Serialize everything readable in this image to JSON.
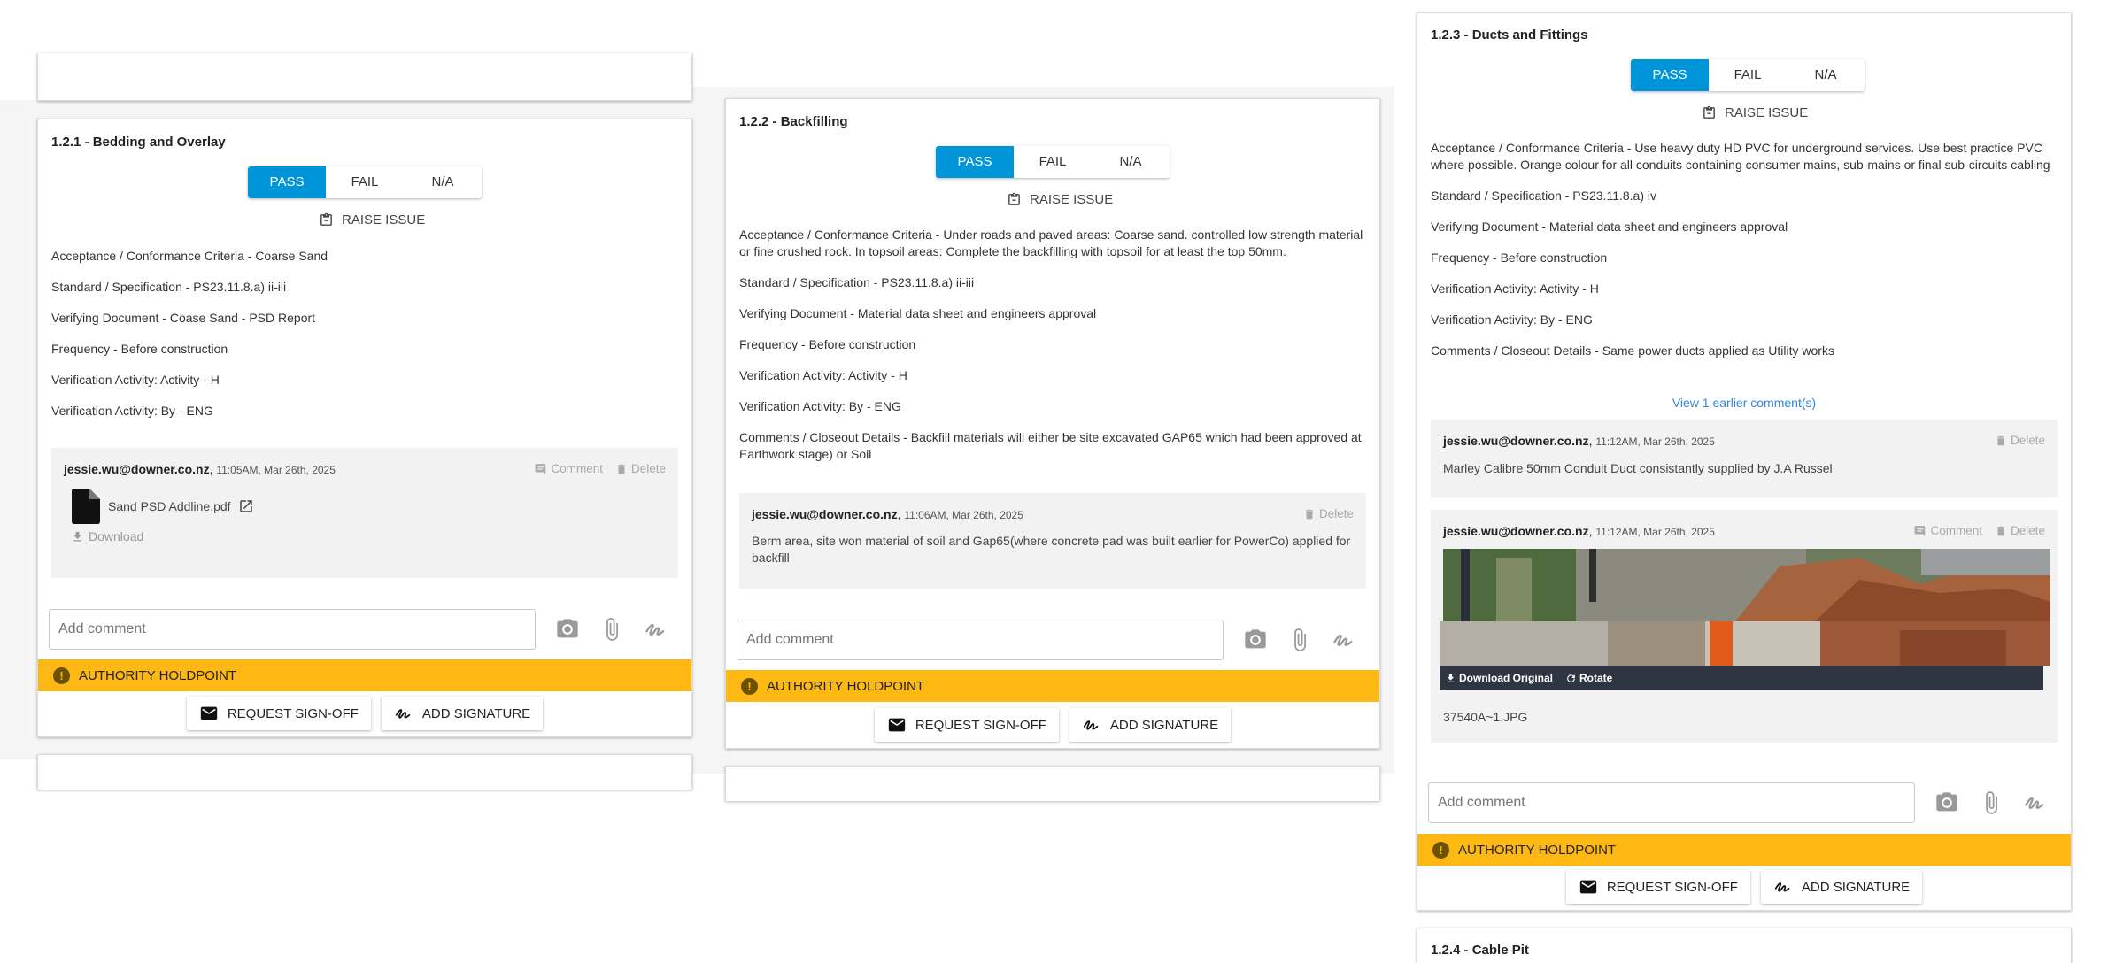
{
  "common": {
    "pass": "PASS",
    "fail": "FAIL",
    "na": "N/A",
    "raise_issue": "RAISE ISSUE",
    "add_comment_placeholder": "Add comment",
    "authority_holdpoint": "AUTHORITY HOLDPOINT",
    "request_signoff": "REQUEST SIGN-OFF",
    "add_signature": "ADD SIGNATURE",
    "comment_label": "Comment",
    "delete_label": "Delete",
    "accent_color": "#0095d8",
    "holdpoint_color": "#fdb813"
  },
  "card1": {
    "title": "1.2.1 - Bedding and Overlay",
    "selected": "PASS",
    "criteria": [
      "Acceptance / Conformance Criteria - Coarse Sand",
      "Standard / Specification - PS23.11.8.a) ii-iii",
      "Verifying Document - Coase Sand - PSD Report",
      "Frequency - Before construction",
      "Verification Activity: Activity - H",
      "Verification Activity: By - ENG"
    ],
    "comment": {
      "author": "jessie.wu@downer.co.nz",
      "timestamp": "11:05AM, Mar 26th, 2025",
      "file_name": "Sand PSD Addline.pdf",
      "download": "Download"
    }
  },
  "card2": {
    "title": "1.2.2 - Backfilling",
    "selected": "PASS",
    "criteria": [
      "Acceptance / Conformance Criteria - Under roads and paved areas: Coarse sand. controlled low strength material or fine crushed rock. In topsoil areas: Complete the backfilling with topsoil for at least the top 50mm.",
      "Standard / Specification - PS23.11.8.a) ii-iii",
      "Verifying Document - Material data sheet and engineers approval",
      "Frequency - Before construction",
      "Verification Activity: Activity - H",
      "Verification Activity: By - ENG",
      "Comments / Closeout Details - Backfill materials will either be site excavated GAP65 which had been approved at Earthwork stage) or Soil"
    ],
    "comment": {
      "author": "jessie.wu@downer.co.nz",
      "timestamp": "11:06AM, Mar 26th, 2025",
      "text": "Berm area, site won material of soil and Gap65(where concrete pad was built earlier for PowerCo) applied for backfill"
    }
  },
  "card3": {
    "title": "1.2.3 - Ducts and Fittings",
    "selected": "PASS",
    "criteria": [
      "Acceptance / Conformance Criteria - Use heavy duty HD PVC for underground services. Use best practice PVC where possible. Orange colour for all conduits containing consumer mains, sub-mains or final sub-circuits cabling",
      "Standard / Specification - PS23.11.8.a) iv",
      "Verifying Document - Material data sheet and engineers approval",
      "Frequency - Before construction",
      "Verification Activity: Activity - H",
      "Verification Activity: By - ENG",
      "Comments / Closeout Details - Same power ducts applied as Utility works"
    ],
    "earlier_comments_link": "View 1 earlier comment(s)",
    "comment1": {
      "author": "jessie.wu@downer.co.nz",
      "timestamp": "11:12AM, Mar 26th, 2025",
      "text": "Marley Calibre 50mm Conduit Duct consistantly supplied by J.A Russel"
    },
    "comment2": {
      "author": "jessie.wu@downer.co.nz",
      "timestamp": "11:12AM, Mar 26th, 2025",
      "download_original": "Download Original",
      "rotate": "Rotate",
      "file_name": "37540A~1.JPG"
    }
  },
  "card4": {
    "title": "1.2.4 - Cable Pit"
  }
}
